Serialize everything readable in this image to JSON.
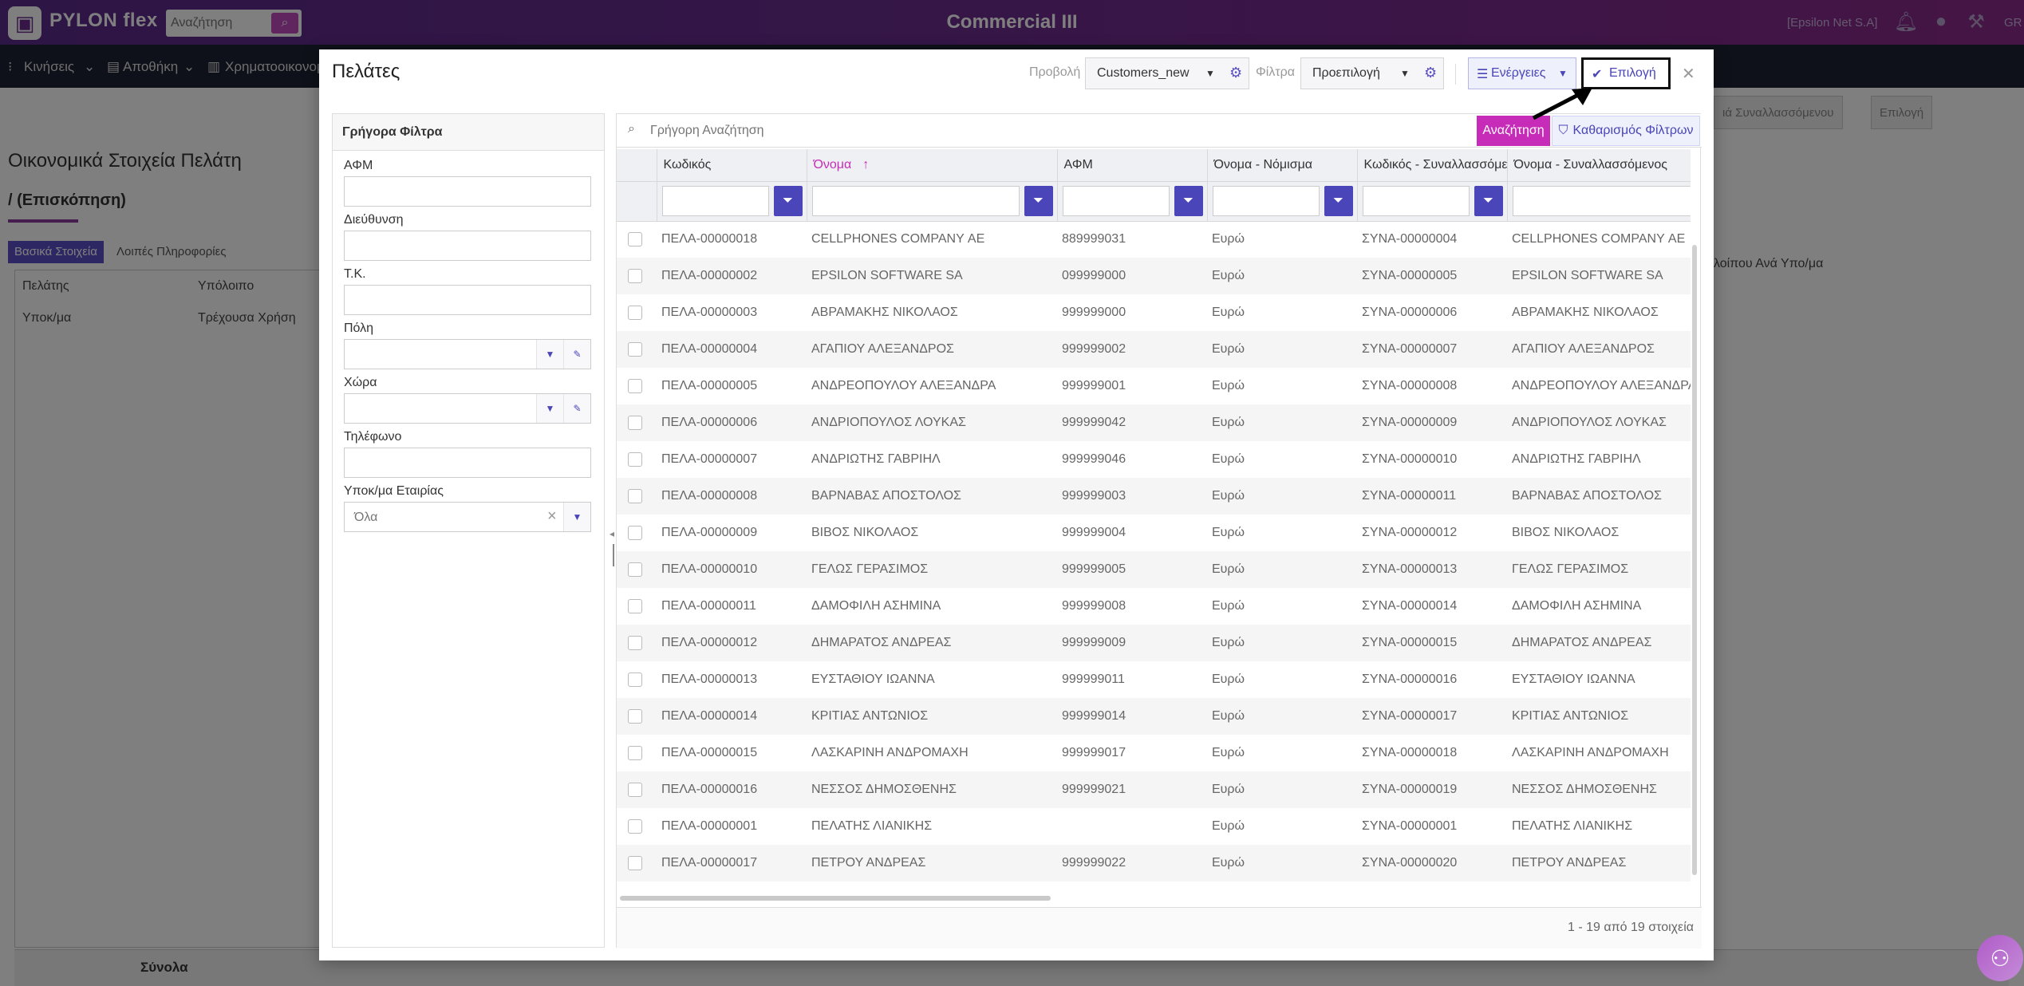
{
  "topbar": {
    "brand": "PYLON flex",
    "search_placeholder": "Αναζήτηση",
    "app_title": "Commercial III",
    "company": "[Epsilon Net S.A]",
    "lang": "GR"
  },
  "menubar": {
    "items": [
      "Κινήσεις",
      "Αποθήκη",
      "Χρηματοοικονομ"
    ]
  },
  "background": {
    "title": "Οικονομικά Στοιχεία Πελάτη",
    "subtitle": "/ (Επισκόπηση)",
    "tabs": [
      "Βασικά Στοιχεία",
      "Λοιπές Πληροφορίες"
    ],
    "cells": [
      "Πελάτης",
      "Υπόλοιπο",
      "Υποκ/μα",
      "Τρέχουσα Χρήση"
    ],
    "right_text": "λοίπου Ανά Υπο/μα",
    "right_btn1": "ιά Συναλλασσόμενου",
    "right_btn2": "Επιλογή",
    "footer": "Σύνολα"
  },
  "modal": {
    "title": "Πελάτες",
    "view_label": "Προβολή",
    "view_value": "Customers_new",
    "filters_label": "Φίλτρα",
    "filters_value": "Προεπιλογή",
    "actions_label": "Ενέργειες",
    "select_label": "Επιλογή"
  },
  "quick_filters": {
    "title": "Γρήγορα Φίλτρα",
    "fields": {
      "afm": "ΑΦΜ",
      "address": "Διεύθυνση",
      "zip": "Τ.Κ.",
      "city": "Πόλη",
      "country": "Χώρα",
      "phone": "Τηλέφωνο",
      "branch": "Υποκ/μα Εταιρίας"
    },
    "branch_value": "Όλα"
  },
  "grid": {
    "search_placeholder": "Γρήγορη Αναζήτηση",
    "search_btn": "Αναζήτηση",
    "clear_btn": "Καθαρισμός Φίλτρων",
    "columns": [
      "Κωδικός",
      "Όνομα",
      "ΑΦΜ",
      "Όνομα - Νόμισμα",
      "Κωδικός - Συναλλασσόμενος",
      "Όνομα - Συναλλασσόμενος"
    ],
    "rows": [
      [
        "ΠΕΛΑ-00000018",
        "CELLPHONES COMPANY ΑΕ",
        "889999031",
        "Ευρώ",
        "ΣΥΝΑ-00000004",
        "CELLPHONES COMPANY ΑΕ"
      ],
      [
        "ΠΕΛΑ-00000002",
        "EPSILON SOFTWARE SA",
        "099999000",
        "Ευρώ",
        "ΣΥΝΑ-00000005",
        "EPSILON SOFTWARE SA"
      ],
      [
        "ΠΕΛΑ-00000003",
        "ΑΒΡΑΜΑΚΗΣ ΝΙΚΟΛΑΟΣ",
        "999999000",
        "Ευρώ",
        "ΣΥΝΑ-00000006",
        "ΑΒΡΑΜΑΚΗΣ ΝΙΚΟΛΑΟΣ"
      ],
      [
        "ΠΕΛΑ-00000004",
        "ΑΓΑΠΙΟΥ ΑΛΕΞΑΝΔΡΟΣ",
        "999999002",
        "Ευρώ",
        "ΣΥΝΑ-00000007",
        "ΑΓΑΠΙΟΥ ΑΛΕΞΑΝΔΡΟΣ"
      ],
      [
        "ΠΕΛΑ-00000005",
        "ΑΝΔΡΕΟΠΟΥΛΟΥ ΑΛΕΞΑΝΔΡΑ",
        "999999001",
        "Ευρώ",
        "ΣΥΝΑ-00000008",
        "ΑΝΔΡΕΟΠΟΥΛΟΥ ΑΛΕΞΑΝΔΡΑ"
      ],
      [
        "ΠΕΛΑ-00000006",
        "ΑΝΔΡΙΟΠΟΥΛΟΣ ΛΟΥΚΑΣ",
        "999999042",
        "Ευρώ",
        "ΣΥΝΑ-00000009",
        "ΑΝΔΡΙΟΠΟΥΛΟΣ ΛΟΥΚΑΣ"
      ],
      [
        "ΠΕΛΑ-00000007",
        "ΑΝΔΡΙΩΤΗΣ ΓΑΒΡΙΗΛ",
        "999999046",
        "Ευρώ",
        "ΣΥΝΑ-00000010",
        "ΑΝΔΡΙΩΤΗΣ ΓΑΒΡΙΗΛ"
      ],
      [
        "ΠΕΛΑ-00000008",
        "ΒΑΡΝΑΒΑΣ ΑΠΟΣΤΟΛΟΣ",
        "999999003",
        "Ευρώ",
        "ΣΥΝΑ-00000011",
        "ΒΑΡΝΑΒΑΣ ΑΠΟΣΤΟΛΟΣ"
      ],
      [
        "ΠΕΛΑ-00000009",
        "ΒΙΒΟΣ ΝΙΚΟΛΑΟΣ",
        "999999004",
        "Ευρώ",
        "ΣΥΝΑ-00000012",
        "ΒΙΒΟΣ ΝΙΚΟΛΑΟΣ"
      ],
      [
        "ΠΕΛΑ-00000010",
        "ΓΕΛΩΣ ΓΕΡΑΣΙΜΟΣ",
        "999999005",
        "Ευρώ",
        "ΣΥΝΑ-00000013",
        "ΓΕΛΩΣ ΓΕΡΑΣΙΜΟΣ"
      ],
      [
        "ΠΕΛΑ-00000011",
        "ΔΑΜΟΦΙΛΗ ΑΣΗΜΙΝΑ",
        "999999008",
        "Ευρώ",
        "ΣΥΝΑ-00000014",
        "ΔΑΜΟΦΙΛΗ ΑΣΗΜΙΝΑ"
      ],
      [
        "ΠΕΛΑ-00000012",
        "ΔΗΜΑΡΑΤΟΣ ΑΝΔΡΕΑΣ",
        "999999009",
        "Ευρώ",
        "ΣΥΝΑ-00000015",
        "ΔΗΜΑΡΑΤΟΣ ΑΝΔΡΕΑΣ"
      ],
      [
        "ΠΕΛΑ-00000013",
        "ΕΥΣΤΑΘΙΟΥ ΙΩΑΝΝΑ",
        "999999011",
        "Ευρώ",
        "ΣΥΝΑ-00000016",
        "ΕΥΣΤΑΘΙΟΥ ΙΩΑΝΝΑ"
      ],
      [
        "ΠΕΛΑ-00000014",
        "ΚΡΙΤΙΑΣ ΑΝΤΩΝΙΟΣ",
        "999999014",
        "Ευρώ",
        "ΣΥΝΑ-00000017",
        "ΚΡΙΤΙΑΣ ΑΝΤΩΝΙΟΣ"
      ],
      [
        "ΠΕΛΑ-00000015",
        "ΛΑΣΚΑΡΙΝΗ ΑΝΔΡΟΜΑΧΗ",
        "999999017",
        "Ευρώ",
        "ΣΥΝΑ-00000018",
        "ΛΑΣΚΑΡΙΝΗ ΑΝΔΡΟΜΑΧΗ"
      ],
      [
        "ΠΕΛΑ-00000016",
        "ΝΕΣΣΟΣ ΔΗΜΟΣΘΕΝΗΣ",
        "999999021",
        "Ευρώ",
        "ΣΥΝΑ-00000019",
        "ΝΕΣΣΟΣ ΔΗΜΟΣΘΕΝΗΣ"
      ],
      [
        "ΠΕΛΑ-00000001",
        "ΠΕΛΑΤΗΣ ΛΙΑΝΙΚΗΣ",
        "",
        "Ευρώ",
        "ΣΥΝΑ-00000001",
        "ΠΕΛΑΤΗΣ ΛΙΑΝΙΚΗΣ"
      ],
      [
        "ΠΕΛΑ-00000017",
        "ΠΕΤΡΟΥ ΑΝΔΡΕΑΣ",
        "999999022",
        "Ευρώ",
        "ΣΥΝΑ-00000020",
        "ΠΕΤΡΟΥ ΑΝΔΡΕΑΣ"
      ]
    ],
    "footer": "1 - 19 από 19 στοιχεία"
  },
  "colors": {
    "accent": "#c72cb8",
    "primary": "#4a45b8",
    "topbar": "#6a2d8f"
  }
}
